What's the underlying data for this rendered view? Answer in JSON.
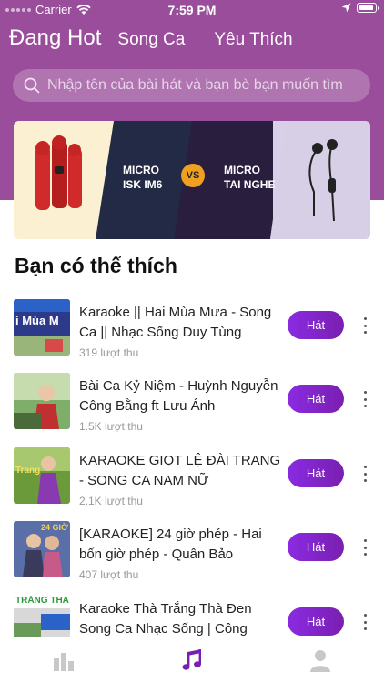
{
  "status_bar": {
    "carrier": "Carrier",
    "time": "7:59 PM"
  },
  "tabs": [
    {
      "label": "Đang Hot",
      "active": true
    },
    {
      "label": "Song Ca",
      "active": false
    },
    {
      "label": "Yêu Thích",
      "active": false
    }
  ],
  "search": {
    "placeholder": "Nhập tên của bài hát và bạn bè bạn muốn tìm"
  },
  "banner": {
    "left_text": "MICRO\nISK IM6",
    "vs": "VS",
    "right_text": "MICRO\nTAI NGHE"
  },
  "section_title": "Bạn có thể thích",
  "songs": [
    {
      "title": "Karaoke || Hai Mùa Mưa - Song Ca || Nhạc Sống Duy Tùng",
      "plays": "319 lượt thu",
      "button": "Hát",
      "thumb_text": "i Mùa M"
    },
    {
      "title": "Bài Ca Kỷ Niệm - Huỳnh Nguyễn Công Bằng ft Lưu Ánh",
      "plays": "1.5K lượt thu",
      "button": "Hát",
      "thumb_text": ""
    },
    {
      "title": "KARAOKE GIỌT LỆ ĐÀI TRANG - SONG CA NAM NỮ",
      "plays": "2.1K lượt thu",
      "button": "Hát",
      "thumb_text": "Trang"
    },
    {
      "title": "[KARAOKE] 24 giờ phép - Hai bốn giờ phép - Quân Bảo",
      "plays": "407 lượt thu",
      "button": "Hát",
      "thumb_text": "24 GIỜ"
    },
    {
      "title": "Karaoke Thà Trắng Thà Đen Song Ca Nhạc Sống | Công",
      "plays": "",
      "button": "Hát",
      "thumb_text": "TRẮNG THÀ"
    }
  ],
  "colors": {
    "header": "#9a4d9a",
    "accent": "#8a2be2"
  },
  "bottom_nav": [
    {
      "icon": "chart-icon",
      "active": false
    },
    {
      "icon": "music-note-icon",
      "active": true
    },
    {
      "icon": "profile-icon",
      "active": false
    }
  ]
}
